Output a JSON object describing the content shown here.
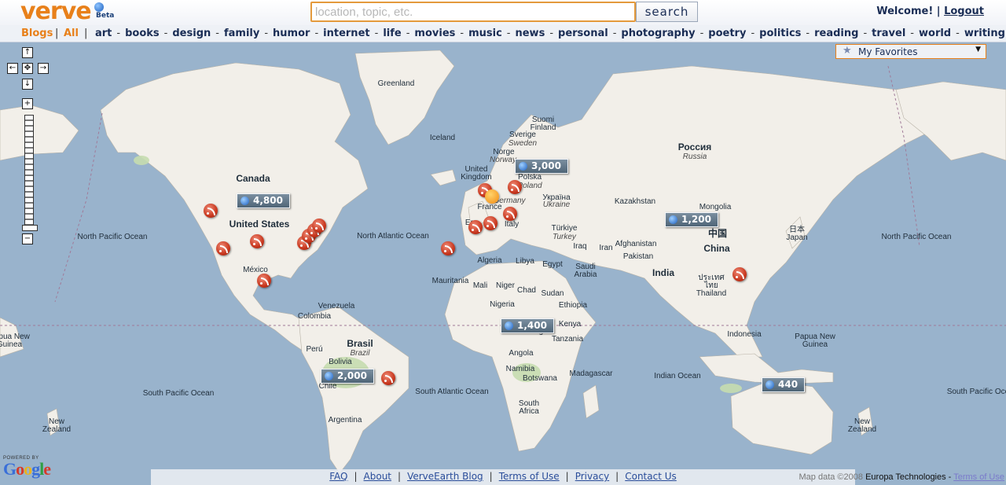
{
  "app": {
    "logo_text": "verve",
    "beta_label": "Beta"
  },
  "header": {
    "search_placeholder": "location, topic, etc.",
    "search_button": "search",
    "welcome": "Welcome!",
    "separator": "|",
    "logout": "Logout"
  },
  "nav": {
    "blogs": "Blogs",
    "separator": "|",
    "all": "All",
    "categories": [
      "art",
      "books",
      "design",
      "family",
      "humor",
      "internet",
      "life",
      "movies",
      "music",
      "news",
      "personal",
      "photography",
      "poetry",
      "politics",
      "reading",
      "travel",
      "world",
      "writing"
    ],
    "dash": "-"
  },
  "map": {
    "favorites_label": "My Favorites",
    "zoom_level": 0.7,
    "controls": {
      "up": "↑",
      "left": "←",
      "center": "✥",
      "right": "→",
      "down": "↓",
      "zoom_in": "+",
      "zoom_out": "−"
    },
    "ocean_labels": [
      "North Pacific Ocean",
      "North Atlantic Ocean",
      "North Pacific Ocean",
      "South Pacific Ocean",
      "South Atlantic Ocean",
      "Indian Ocean",
      "South Pacific Ocean"
    ],
    "land_labels": [
      {
        "text": "Greenland",
        "style": ""
      },
      {
        "text": "Iceland",
        "style": ""
      },
      {
        "text": "Canada",
        "style": "big"
      },
      {
        "text": "United States",
        "style": "big"
      },
      {
        "text": "México",
        "style": ""
      },
      {
        "text": "Venezuela",
        "style": ""
      },
      {
        "text": "Colombia",
        "style": ""
      },
      {
        "text": "Perú",
        "style": ""
      },
      {
        "text": "Brasil",
        "style": "big"
      },
      {
        "text": "Brazil",
        "style": "it"
      },
      {
        "text": "Bolivia",
        "style": ""
      },
      {
        "text": "Chile",
        "style": ""
      },
      {
        "text": "Argentina",
        "style": ""
      },
      {
        "text": "Suomi\nFinland",
        "style": ""
      },
      {
        "text": "Sverige",
        "style": ""
      },
      {
        "text": "Sweden",
        "style": "it"
      },
      {
        "text": "Norge",
        "style": ""
      },
      {
        "text": "Norway",
        "style": "it"
      },
      {
        "text": "United\nKingdom",
        "style": ""
      },
      {
        "text": "Polska",
        "style": ""
      },
      {
        "text": "Poland",
        "style": "it"
      },
      {
        "text": "Україна",
        "style": ""
      },
      {
        "text": "Ukraine",
        "style": "it"
      },
      {
        "text": "France",
        "style": ""
      },
      {
        "text": "Germany",
        "style": "it"
      },
      {
        "text": "Italy",
        "style": ""
      },
      {
        "text": "Türkiye",
        "style": ""
      },
      {
        "text": "Turkey",
        "style": "it"
      },
      {
        "text": "Россия",
        "style": "big"
      },
      {
        "text": "Russia",
        "style": "it"
      },
      {
        "text": "Kazakhstan",
        "style": ""
      },
      {
        "text": "Mongolia",
        "style": ""
      },
      {
        "text": "中国",
        "style": "big"
      },
      {
        "text": "China",
        "style": "big"
      },
      {
        "text": "日本\nJapan",
        "style": ""
      },
      {
        "text": "Iraq",
        "style": ""
      },
      {
        "text": "Iran",
        "style": ""
      },
      {
        "text": "Afghanistan",
        "style": ""
      },
      {
        "text": "Pakistan",
        "style": ""
      },
      {
        "text": "India",
        "style": "big"
      },
      {
        "text": "ประเทศ\nไทย\nThailand",
        "style": ""
      },
      {
        "text": "Saudi\nArabia",
        "style": ""
      },
      {
        "text": "Egypt",
        "style": ""
      },
      {
        "text": "Libya",
        "style": ""
      },
      {
        "text": "Algeria",
        "style": ""
      },
      {
        "text": "Mauritania",
        "style": ""
      },
      {
        "text": "Mali",
        "style": ""
      },
      {
        "text": "Niger",
        "style": ""
      },
      {
        "text": "Chad",
        "style": ""
      },
      {
        "text": "Sudan",
        "style": ""
      },
      {
        "text": "Nigeria",
        "style": ""
      },
      {
        "text": "Ethiopia",
        "style": ""
      },
      {
        "text": "Kenya",
        "style": ""
      },
      {
        "text": "Tanzania",
        "style": ""
      },
      {
        "text": "Congo",
        "style": ""
      },
      {
        "text": "Angola",
        "style": ""
      },
      {
        "text": "Namibia",
        "style": ""
      },
      {
        "text": "Botswana",
        "style": ""
      },
      {
        "text": "Madagascar",
        "style": ""
      },
      {
        "text": "South\nAfrica",
        "style": ""
      },
      {
        "text": "Indonesia",
        "style": ""
      },
      {
        "text": "Papua New\nGuinea",
        "style": ""
      },
      {
        "text": "Papua New\nGuinea",
        "style": ""
      },
      {
        "text": "New\nZealand",
        "style": ""
      },
      {
        "text": "New\nZealand",
        "style": ""
      },
      {
        "text": "Eg",
        "style": ""
      }
    ],
    "clusters": [
      "4,800",
      "3,000",
      "1,200",
      "1,400",
      "2,000",
      "440"
    ]
  },
  "footer": {
    "links": [
      "FAQ",
      "About",
      "VerveEarth Blog",
      "Terms of Use",
      "Privacy",
      "Contact Us"
    ],
    "separator": "|",
    "map_data": "Map data ©2008",
    "data_owner": "Europa Technologies -",
    "terms": "Terms of Use",
    "powered_by": "POWERED BY",
    "google": "Google"
  },
  "colors": {
    "ocean": "#99b3cc",
    "land": "#f2efe9",
    "forest": "#c5dcaf",
    "brand": "#e8801a",
    "navy": "#1a2d55"
  }
}
